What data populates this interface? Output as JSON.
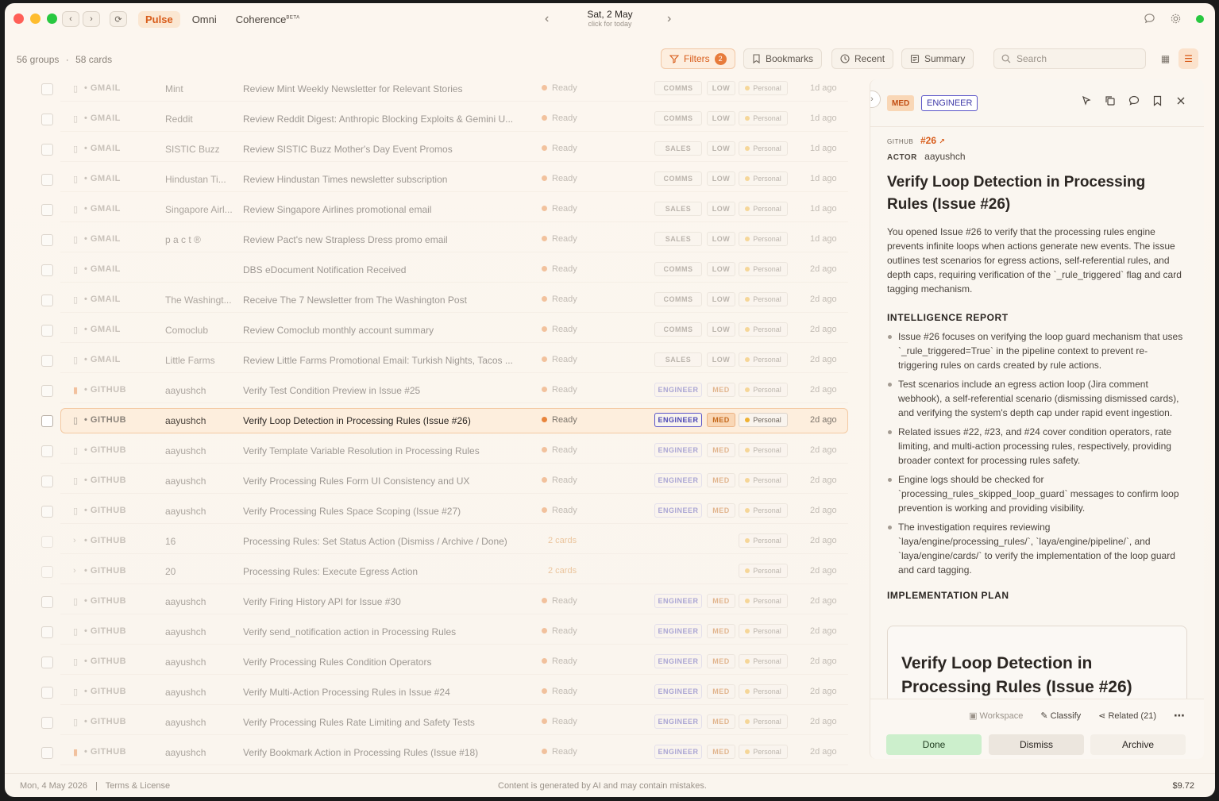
{
  "app": {
    "tabs": [
      {
        "label": "Pulse",
        "active": true
      },
      {
        "label": "Omni",
        "active": false
      },
      {
        "label": "Coherence",
        "active": false,
        "badge": "BETA"
      }
    ],
    "date": {
      "main": "Sat, 2 May",
      "sub": "click for today"
    },
    "accent": "#d85c1a"
  },
  "toolbar": {
    "groups": "56 groups",
    "cards": "58 cards",
    "filters_label": "Filters",
    "filters_count": "2",
    "bookmarks_label": "Bookmarks",
    "recent_label": "Recent",
    "summary_label": "Summary",
    "search_placeholder": "Search"
  },
  "rows": [
    {
      "source": "GMAIL",
      "actor": "Mint",
      "title": "Review Mint Weekly Newsletter for Relevant Stories",
      "status": "Ready",
      "category": "COMMS",
      "priority": "LOW",
      "space": "Personal",
      "ago": "1d ago"
    },
    {
      "source": "GMAIL",
      "actor": "Reddit",
      "title": "Review Reddit Digest: Anthropic Blocking Exploits & Gemini U...",
      "status": "Ready",
      "category": "COMMS",
      "priority": "LOW",
      "space": "Personal",
      "ago": "1d ago"
    },
    {
      "source": "GMAIL",
      "actor": "SISTIC Buzz",
      "title": "Review SISTIC Buzz Mother's Day Event Promos",
      "status": "Ready",
      "category": "SALES",
      "priority": "LOW",
      "space": "Personal",
      "ago": "1d ago"
    },
    {
      "source": "GMAIL",
      "actor": "Hindustan Ti...",
      "title": "Review Hindustan Times newsletter subscription",
      "status": "Ready",
      "category": "COMMS",
      "priority": "LOW",
      "space": "Personal",
      "ago": "1d ago"
    },
    {
      "source": "GMAIL",
      "actor": "Singapore Airl...",
      "title": "Review Singapore Airlines promotional email",
      "status": "Ready",
      "category": "SALES",
      "priority": "LOW",
      "space": "Personal",
      "ago": "1d ago"
    },
    {
      "source": "GMAIL",
      "actor": "p a c t ®",
      "title": "Review Pact's new Strapless Dress promo email",
      "status": "Ready",
      "category": "SALES",
      "priority": "LOW",
      "space": "Personal",
      "ago": "1d ago"
    },
    {
      "source": "GMAIL",
      "actor": "",
      "title": "DBS eDocument Notification Received",
      "status": "Ready",
      "category": "COMMS",
      "priority": "LOW",
      "space": "Personal",
      "ago": "2d ago"
    },
    {
      "source": "GMAIL",
      "actor": "The Washingt...",
      "title": "Receive The 7 Newsletter from The Washington Post",
      "status": "Ready",
      "category": "COMMS",
      "priority": "LOW",
      "space": "Personal",
      "ago": "2d ago"
    },
    {
      "source": "GMAIL",
      "actor": "Comoclub",
      "title": "Review Comoclub monthly account summary",
      "status": "Ready",
      "category": "COMMS",
      "priority": "LOW",
      "space": "Personal",
      "ago": "2d ago"
    },
    {
      "source": "GMAIL",
      "actor": "Little Farms",
      "title": "Review Little Farms Promotional Email: Turkish Nights, Tacos ...",
      "status": "Ready",
      "category": "SALES",
      "priority": "LOW",
      "space": "Personal",
      "ago": "2d ago"
    },
    {
      "source": "GITHUB",
      "actor": "aayushch",
      "title": "Verify Test Condition Preview in Issue #25",
      "status": "Ready",
      "category": "ENGINEER",
      "priority": "MED",
      "space": "Personal",
      "ago": "2d ago",
      "bookmarked": true
    },
    {
      "source": "GITHUB",
      "actor": "aayushch",
      "title": "Verify Loop Detection in Processing Rules (Issue #26)",
      "status": "Ready",
      "category": "ENGINEER",
      "priority": "MED",
      "space": "Personal",
      "ago": "2d ago",
      "selected": true
    },
    {
      "source": "GITHUB",
      "actor": "aayushch",
      "title": "Verify Template Variable Resolution in Processing Rules",
      "status": "Ready",
      "category": "ENGINEER",
      "priority": "MED",
      "space": "Personal",
      "ago": "2d ago"
    },
    {
      "source": "GITHUB",
      "actor": "aayushch",
      "title": "Verify Processing Rules Form UI Consistency and UX",
      "status": "Ready",
      "category": "ENGINEER",
      "priority": "MED",
      "space": "Personal",
      "ago": "2d ago"
    },
    {
      "source": "GITHUB",
      "actor": "aayushch",
      "title": "Verify Processing Rules Space Scoping (Issue #27)",
      "status": "Ready",
      "category": "ENGINEER",
      "priority": "MED",
      "space": "Personal",
      "ago": "2d ago"
    },
    {
      "source": "GITHUB",
      "actor": "16",
      "title": "Processing Rules: Set Status Action (Dismiss / Archive / Done)",
      "status": "2 cards",
      "category": "",
      "priority": "",
      "space": "Personal",
      "ago": "2d ago",
      "group": true
    },
    {
      "source": "GITHUB",
      "actor": "20",
      "title": "Processing Rules: Execute Egress Action",
      "status": "2 cards",
      "category": "",
      "priority": "",
      "space": "Personal",
      "ago": "2d ago",
      "group": true
    },
    {
      "source": "GITHUB",
      "actor": "aayushch",
      "title": "Verify Firing History API for Issue #30",
      "status": "Ready",
      "category": "ENGINEER",
      "priority": "MED",
      "space": "Personal",
      "ago": "2d ago"
    },
    {
      "source": "GITHUB",
      "actor": "aayushch",
      "title": "Verify send_notification action in Processing Rules",
      "status": "Ready",
      "category": "ENGINEER",
      "priority": "MED",
      "space": "Personal",
      "ago": "2d ago"
    },
    {
      "source": "GITHUB",
      "actor": "aayushch",
      "title": "Verify Processing Rules Condition Operators",
      "status": "Ready",
      "category": "ENGINEER",
      "priority": "MED",
      "space": "Personal",
      "ago": "2d ago"
    },
    {
      "source": "GITHUB",
      "actor": "aayushch",
      "title": "Verify Multi-Action Processing Rules in Issue #24",
      "status": "Ready",
      "category": "ENGINEER",
      "priority": "MED",
      "space": "Personal",
      "ago": "2d ago"
    },
    {
      "source": "GITHUB",
      "actor": "aayushch",
      "title": "Verify Processing Rules Rate Limiting and Safety Tests",
      "status": "Ready",
      "category": "ENGINEER",
      "priority": "MED",
      "space": "Personal",
      "ago": "2d ago"
    },
    {
      "source": "GITHUB",
      "actor": "aayushch",
      "title": "Verify Bookmark Action in Processing Rules (Issue #18)",
      "status": "Ready",
      "category": "ENGINEER",
      "priority": "MED",
      "space": "Personal",
      "ago": "2d ago",
      "bookmarked": true
    }
  ],
  "detail": {
    "priority": "MED",
    "category": "ENGINEER",
    "source": "GITHUB",
    "issue": "#26",
    "actor_label": "ACTOR",
    "actor": "aayushch",
    "title": "Verify Loop Detection in Processing Rules (Issue #26)",
    "description": "You opened Issue #26 to verify that the processing rules engine prevents infinite loops when actions generate new events. The issue outlines test scenarios for egress actions, self-referential rules, and depth caps, requiring verification of the `_rule_triggered` flag and card tagging mechanism.",
    "intel_heading": "INTELLIGENCE REPORT",
    "intel": [
      "Issue #26 focuses on verifying the loop guard mechanism that uses `_rule_triggered=True` in the pipeline context to prevent re-triggering rules on cards created by rule actions.",
      "Test scenarios include an egress action loop (Jira comment webhook), a self-referential scenario (dismissing dismissed cards), and verifying the system's depth cap under rapid event ingestion.",
      "Related issues #22, #23, and #24 cover condition operators, rate limiting, and multi-action processing rules, respectively, providing broader context for processing rules safety.",
      "Engine logs should be checked for `processing_rules_skipped_loop_guard` messages to confirm loop prevention is working and providing visibility.",
      "The investigation requires reviewing `laya/engine/processing_rules/`, `laya/engine/pipeline/`, and `laya/engine/cards/` to verify the implementation of the loop guard and card tagging."
    ],
    "plan_heading": "IMPLEMENTATION PLAN",
    "plan_title": "Verify Loop Detection in Processing Rules (Issue #26)",
    "links": {
      "workspace": "Workspace",
      "classify": "Classify",
      "related": "Related (21)"
    },
    "buttons": {
      "done": "Done",
      "dismiss": "Dismiss",
      "archive": "Archive"
    }
  },
  "statusbar": {
    "date": "Mon, 4 May 2026",
    "sep": "|",
    "terms": "Terms & License",
    "disclaimer": "Content is generated by AI and may contain mistakes.",
    "cost": "$9.72"
  }
}
